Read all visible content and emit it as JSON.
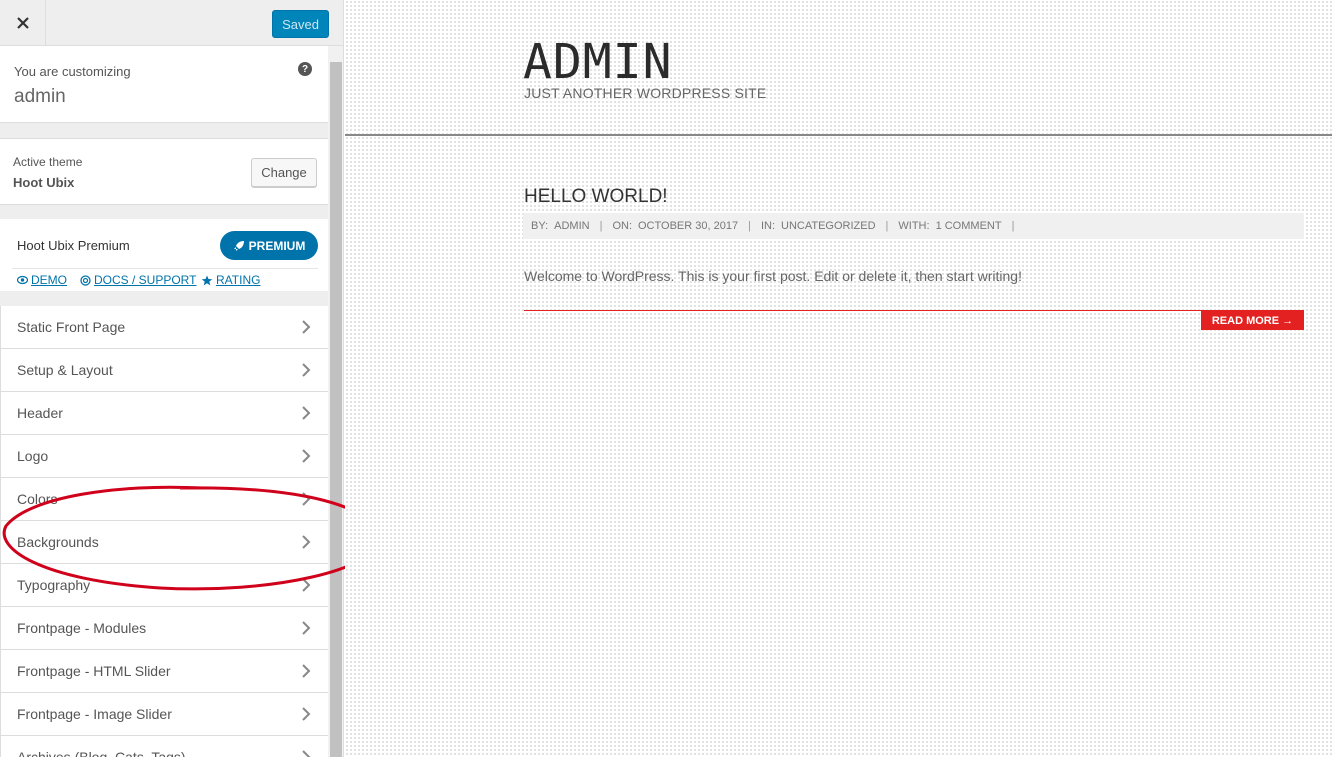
{
  "topbar": {
    "saved_label": "Saved"
  },
  "customizing": {
    "prefix": "You are customizing",
    "site_name": "admin"
  },
  "theme": {
    "label": "Active theme",
    "name": "Hoot Ubix",
    "change_label": "Change"
  },
  "premium": {
    "title": "Hoot Ubix Premium",
    "button_label": "PREMIUM",
    "links": [
      {
        "label": "DEMO",
        "icon": "eye-icon"
      },
      {
        "label": "DOCS / SUPPORT",
        "icon": "lifebuoy-icon"
      },
      {
        "label": "RATING",
        "icon": "star-icon"
      }
    ]
  },
  "menu": {
    "items": [
      {
        "label": "Static Front Page"
      },
      {
        "label": "Setup & Layout"
      },
      {
        "label": "Header"
      },
      {
        "label": "Logo"
      },
      {
        "label": "Colors"
      },
      {
        "label": "Backgrounds"
      },
      {
        "label": "Typography"
      },
      {
        "label": "Frontpage - Modules"
      },
      {
        "label": "Frontpage - HTML Slider"
      },
      {
        "label": "Frontpage - Image Slider"
      },
      {
        "label": "Archives (Blog, Cats, Tags)"
      }
    ]
  },
  "annotation": {
    "highlighted_item": "Backgrounds",
    "color": "#d0021b"
  },
  "preview": {
    "site_title": "ADMIN",
    "tagline": "JUST ANOTHER WORDPRESS SITE",
    "post": {
      "title": "HELLO WORLD!",
      "meta": {
        "by_label": "BY:",
        "author": "ADMIN",
        "on_label": "ON:",
        "date": "OCTOBER 30, 2017",
        "in_label": "IN:",
        "category": "UNCATEGORIZED",
        "with_label": "WITH:",
        "comments": "1 COMMENT",
        "separator": "|"
      },
      "excerpt": "Welcome to WordPress. This is your first post. Edit or delete it, then start writing!",
      "read_more": "READ MORE →"
    }
  },
  "colors": {
    "accent": "#0073aa",
    "saved": "#0085ba",
    "read_more": "#e32121"
  }
}
